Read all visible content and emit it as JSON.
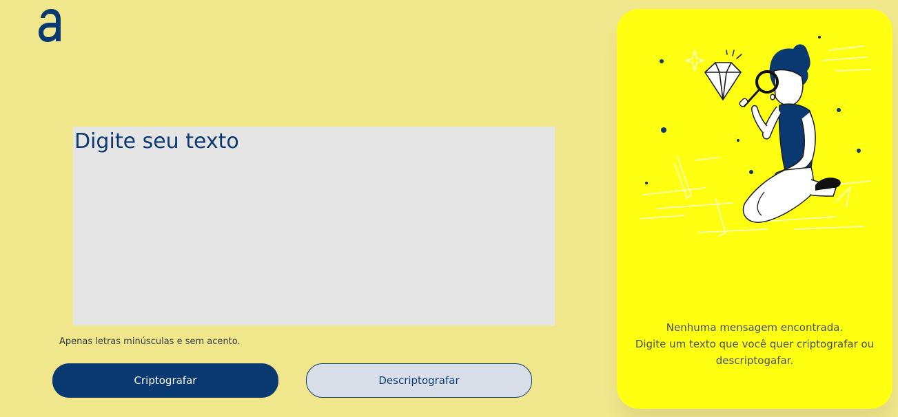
{
  "app": {
    "logo_icon": "logo-letter-a-icon"
  },
  "editor": {
    "placeholder": "Digite seu texto",
    "value": ""
  },
  "hint": {
    "icon": "info-icon",
    "text": "Apenas letras minúsculas e sem acento."
  },
  "buttons": {
    "encrypt_label": "Criptografar",
    "decrypt_label": "Descriptografar"
  },
  "output": {
    "illustration": "person-with-magnifying-glass-diamond-illustration",
    "title": "Nenhuma mensagem encontrada.",
    "subtitle": "Digite um texto que você quer criptografar ou descriptogafar."
  },
  "colors": {
    "background": "#f0e68c",
    "primary": "#0a3871",
    "editor_bg": "#e5e5e5",
    "output_card": "#ffff11",
    "secondary_button": "#d8dfe8"
  }
}
